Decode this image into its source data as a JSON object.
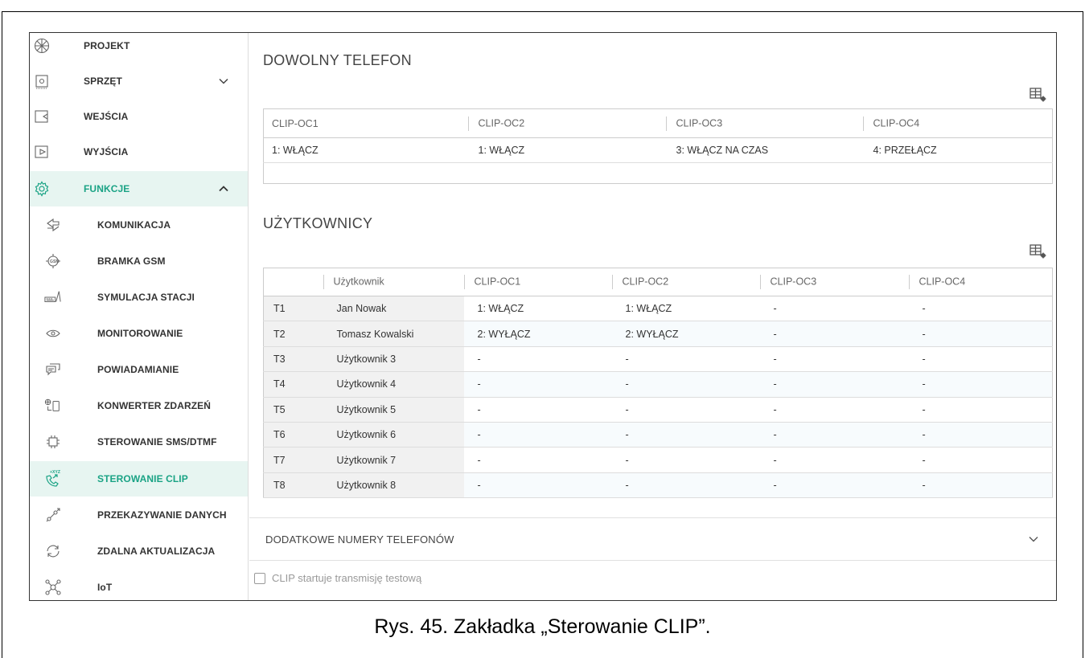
{
  "sidebar": {
    "items": [
      {
        "label": "PROJEKT",
        "icon": "asterisk-burst-icon"
      },
      {
        "label": "SPRZĘT",
        "icon": "chip-icon"
      },
      {
        "label": "WEJŚCIA",
        "icon": "input-icon"
      },
      {
        "label": "WYJŚCIA",
        "icon": "output-icon"
      },
      {
        "label": "FUNKCJE",
        "icon": "gear-icon"
      },
      {
        "label": "KOMUNIKACJA",
        "icon": "communication-icon"
      },
      {
        "label": "BRAMKA GSM",
        "icon": "gsm-icon"
      },
      {
        "label": "SYMULACJA STACJI",
        "icon": "station-icon"
      },
      {
        "label": "MONITOROWANIE",
        "icon": "eye-icon"
      },
      {
        "label": "POWIADAMIANIE",
        "icon": "chat-icon"
      },
      {
        "label": "KONWERTER ZDARZEŃ",
        "icon": "converter-icon"
      },
      {
        "label": "STEROWANIE SMS/DTMF",
        "icon": "sms-control-icon"
      },
      {
        "label": "STEROWANIE CLIP",
        "icon": "clip-phone-icon",
        "badge": "+XYZ"
      },
      {
        "label": "PRZEKAZYWANIE DANYCH",
        "icon": "data-transfer-icon"
      },
      {
        "label": "ZDALNA AKTUALIZACJA",
        "icon": "refresh-icon"
      },
      {
        "label": "IoT",
        "icon": "iot-icon"
      }
    ]
  },
  "section1": {
    "title": "DOWOLNY TELEFON",
    "headers": [
      "CLIP-OC1",
      "CLIP-OC2",
      "CLIP-OC3",
      "CLIP-OC4"
    ],
    "row": [
      "1: WŁĄCZ",
      "1: WŁĄCZ",
      "3: WŁĄCZ NA CZAS",
      "4: PRZEŁĄCZ"
    ]
  },
  "section2": {
    "title": "UŻYTKOWNICY",
    "headers": [
      "",
      "Użytkownik",
      "CLIP-OC1",
      "CLIP-OC2",
      "CLIP-OC3",
      "CLIP-OC4"
    ],
    "rows": [
      [
        "T1",
        "Jan Nowak",
        "1: WŁĄCZ",
        "1: WŁĄCZ",
        "-",
        "-"
      ],
      [
        "T2",
        "Tomasz Kowalski",
        "2: WYŁĄCZ",
        "2: WYŁĄCZ",
        "-",
        "-"
      ],
      [
        "T3",
        "Użytkownik 3",
        "-",
        "-",
        "-",
        "-"
      ],
      [
        "T4",
        "Użytkownik 4",
        "-",
        "-",
        "-",
        "-"
      ],
      [
        "T5",
        "Użytkownik 5",
        "-",
        "-",
        "-",
        "-"
      ],
      [
        "T6",
        "Użytkownik 6",
        "-",
        "-",
        "-",
        "-"
      ],
      [
        "T7",
        "Użytkownik 7",
        "-",
        "-",
        "-",
        "-"
      ],
      [
        "T8",
        "Użytkownik 8",
        "-",
        "-",
        "-",
        "-"
      ]
    ]
  },
  "extra": {
    "label": "DODATKOWE NUMERY TELEFONÓW"
  },
  "checkbox": {
    "label": "CLIP startuje transmisję testową",
    "checked": false
  },
  "caption": "Rys. 45. Zakładka „Sterowanie CLIP”.",
  "colors": {
    "accent": "#1aa385",
    "active_bg": "#e7f5f1"
  }
}
